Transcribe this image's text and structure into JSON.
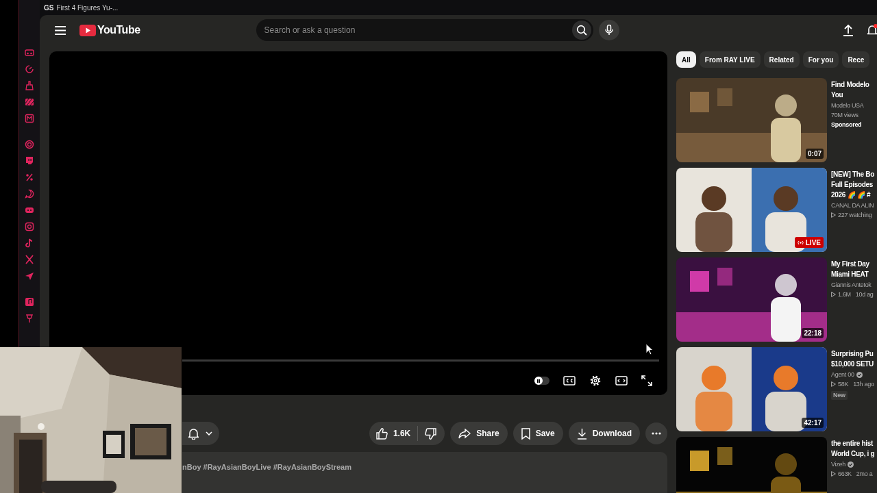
{
  "browser_tab": {
    "favicon_text": "GS",
    "title": "First 4 Figures Yu-..."
  },
  "header": {
    "logo": "YouTube",
    "search": {
      "placeholder": "Search or ask a question"
    },
    "notification_dot": true
  },
  "player": {
    "autoplay_on": false,
    "progress": {
      "level": 0
    }
  },
  "actions": {
    "likes": "1.6K",
    "buttons": [
      {
        "kind": "share",
        "label": "Share"
      },
      {
        "kind": "save",
        "label": "Save"
      },
      {
        "kind": "download",
        "label": "Download"
      }
    ]
  },
  "description": "nBoy #RayAsianBoyLive #RayAsianBoyStream",
  "chips": [
    {
      "label": "All",
      "selected": true
    },
    {
      "label": "From RAY LIVE",
      "selected": false
    },
    {
      "label": "Related",
      "selected": false
    },
    {
      "label": "For you",
      "selected": false
    },
    {
      "label": "Rece",
      "selected": false
    }
  ],
  "videos": [
    {
      "title": [
        "Find Modelo",
        "You"
      ],
      "channel": "Modelo USA",
      "verified": false,
      "stats": "70M views",
      "play_mark": false,
      "sponsored": "Sponsored",
      "duration": "0:07"
    },
    {
      "title": [
        "[NEW] The Bo",
        "Full Episodes",
        "2026 🌈 🌈 #"
      ],
      "channel": "CANAL DA ALIN",
      "verified": false,
      "stats": "227 watching",
      "play_mark": true,
      "live": "LIVE"
    },
    {
      "title": [
        "My First Day",
        "Miami HEAT"
      ],
      "channel": "Giannis Antetok",
      "verified": false,
      "stats": "1.6M",
      "age": "10d ag",
      "play_mark": true,
      "duration": "22:18"
    },
    {
      "title": [
        "Surprising Pu",
        "$10,000 SETU"
      ],
      "channel": "Agent 00",
      "verified": true,
      "stats": "58K",
      "age": "13h ago",
      "play_mark": true,
      "new_badge": "New",
      "duration": "42:17"
    },
    {
      "title": [
        "the entire hist",
        "World Cup, i g"
      ],
      "channel": "Vizeh",
      "verified": true,
      "stats": "663K",
      "age": "2mo a",
      "play_mark": true
    }
  ]
}
